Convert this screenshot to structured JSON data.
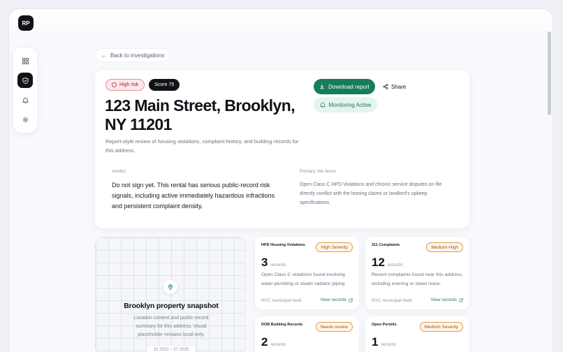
{
  "user": {
    "initials": "RP"
  },
  "nav": {
    "items": [
      {
        "name": "dashboard",
        "icon": "grid-icon",
        "active": false
      },
      {
        "name": "investigations",
        "icon": "shield-icon",
        "active": true
      },
      {
        "name": "alerts",
        "icon": "bell-icon",
        "active": false
      },
      {
        "name": "settings",
        "icon": "gear-icon",
        "active": false
      }
    ]
  },
  "back_link": {
    "label": "Back to investigations"
  },
  "report": {
    "risk_badge": "High risk",
    "score_badge": "Score 75",
    "title": "123 Main Street, Brooklyn, NY 11201",
    "subtitle": "Report-style review of housing violations, complaint history, and building records for this address.",
    "download_label": "Download report",
    "share_label": "Share",
    "monitoring_label": "Monitoring Active",
    "verdict_label": "Verdict",
    "verdict_text": "Do not sign yet. This rental has serious public-record risk signals, including active immediately hazardous infractions and persistent complaint density.",
    "primary_risk_label": "Primary risk factor",
    "primary_risk_text": "Open Class C HPD Violations and chronic service disputes on file directly conflict with the leasing claims or landlord's upkeep specifications."
  },
  "map": {
    "title": "Brooklyn property snapshot",
    "description": "Location context and public-record summary for this address. Visual placeholder remains local-only.",
    "chip": "10 2022 – 07 2025"
  },
  "records": [
    {
      "name": "HPD Housing Violations",
      "severity": "High Severity",
      "count": "3",
      "unit": "records",
      "description": "Open Class C violations found involving water plumbing or steam radiator piping.",
      "source": "NYC municipal feed",
      "link": "View records"
    },
    {
      "name": "311 Complaints",
      "severity": "Medium-High",
      "count": "12",
      "unit": "records",
      "description": "Recent complaints found near this address, including evening or street noise.",
      "source": "NYC municipal feed",
      "link": "View records"
    },
    {
      "name": "DOB Building Records",
      "severity": "Needs review",
      "count": "2",
      "unit": "records",
      "description": "",
      "source": "",
      "link": ""
    },
    {
      "name": "Open Permits",
      "severity": "Medium Severity",
      "count": "1",
      "unit": "records",
      "description": "",
      "source": "",
      "link": ""
    }
  ],
  "colors": {
    "accent_green": "#157c5c",
    "danger_red": "#a42330",
    "warning_amber": "#9a5a12",
    "ink": "#111318"
  }
}
